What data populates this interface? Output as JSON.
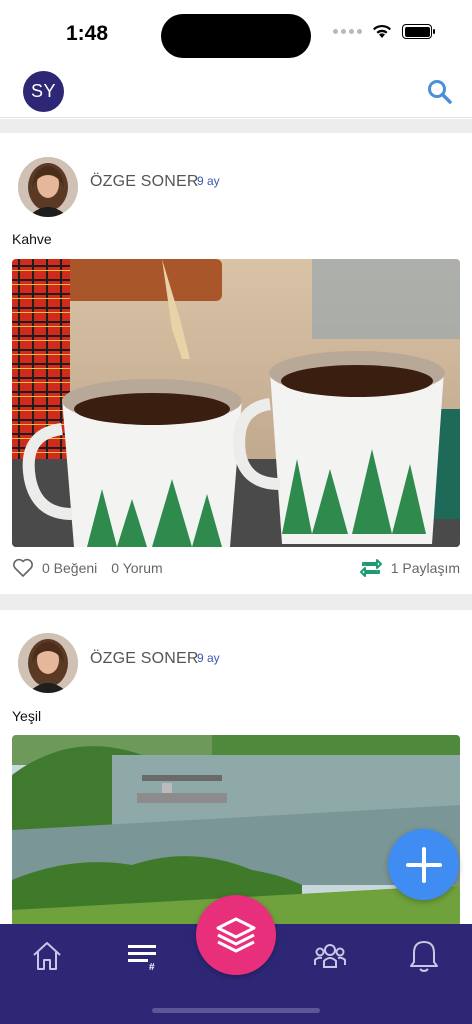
{
  "status_bar": {
    "time": "1:48"
  },
  "header": {
    "avatar_initials": "SY",
    "search_icon": "search-icon"
  },
  "posts": [
    {
      "author": "ÖZGE SONER",
      "time": "9 ay",
      "text": "Kahve",
      "likes": "0 Beğeni",
      "comments": "0 Yorum",
      "shares": "1 Paylaşım"
    },
    {
      "author": "ÖZGE SONER",
      "time": "9 ay",
      "text": "Yeşil"
    }
  ],
  "bottom_nav": {
    "items": [
      "home-icon",
      "feed-list-icon",
      "layers-icon",
      "groups-icon",
      "bell-icon"
    ]
  },
  "colors": {
    "brand": "#2d2776",
    "accent_pink": "#e72f7c",
    "fab_blue": "#3f8cf2",
    "share_green": "#1f9b70"
  }
}
